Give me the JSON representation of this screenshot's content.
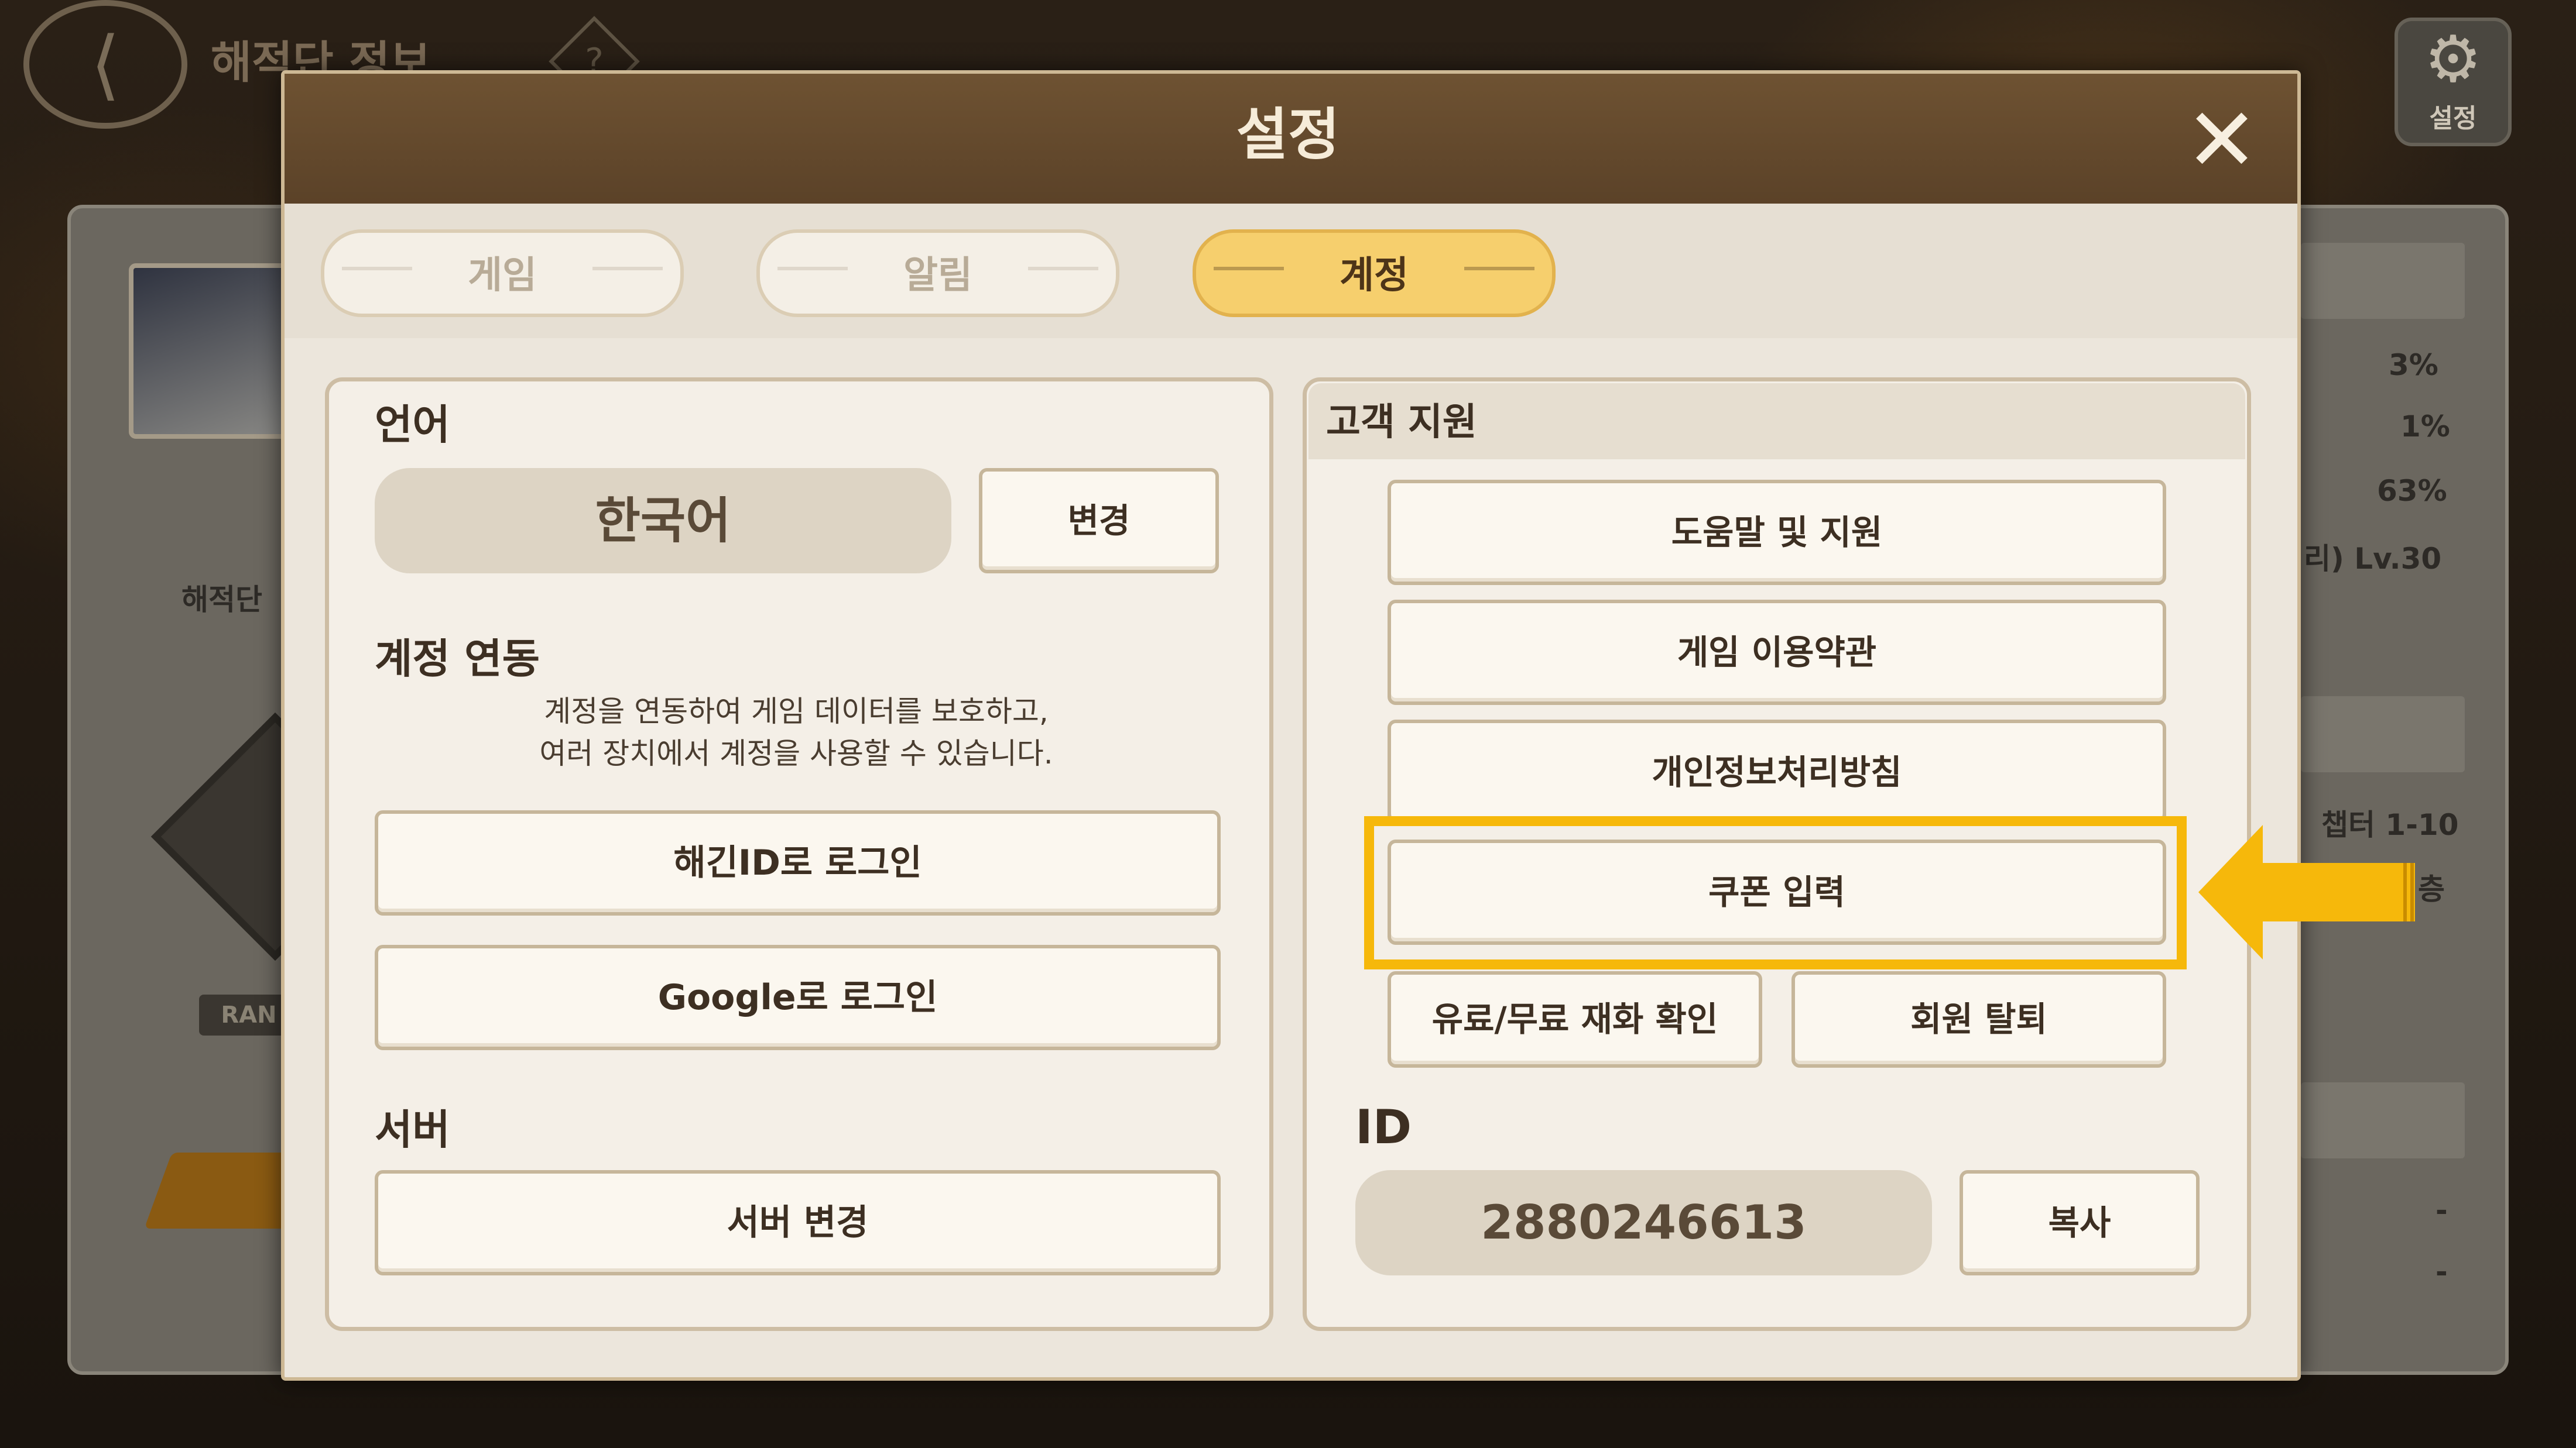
{
  "background": {
    "title": "해적단 정보",
    "help_icon_label": "?",
    "settings_label": "설정",
    "stats": [
      "3%",
      "1%",
      "63%",
      "리) Lv.30",
      "챕터 1-10",
      "층",
      "-",
      "-"
    ],
    "left_label": "해적단",
    "rank_label": "RAN"
  },
  "dialog": {
    "title": "설정",
    "close_icon": "close-icon"
  },
  "tabs": [
    {
      "label": "게임",
      "active": false
    },
    {
      "label": "알림",
      "active": false
    },
    {
      "label": "계정",
      "active": true
    }
  ],
  "left": {
    "language_title": "언어",
    "language_value": "한국어",
    "change_button": "변경",
    "account_link_title": "계정 연동",
    "account_link_desc_1": "계정을 연동하여 게임 데이터를 보호하고,",
    "account_link_desc_2": "여러 장치에서 계정을 사용할 수 있습니다.",
    "login_haegin": "해긴ID로 로그인",
    "login_google": "Google로 로그인",
    "server_title": "서버",
    "server_change": "서버 변경"
  },
  "right": {
    "support_title": "고객 지원",
    "help_support": "도움말 및 지원",
    "terms": "게임 이용약관",
    "privacy": "개인정보처리방침",
    "coupon": "쿠폰 입력",
    "paid_free_check": "유료/무료 재화 확인",
    "withdraw": "회원 탈퇴",
    "id_title": "ID",
    "id_value": "2880246613",
    "copy_button": "복사"
  },
  "colors": {
    "highlight": "#f6b80b",
    "header_brown": "#5b4228",
    "active_tab": "#f6cf6d"
  }
}
